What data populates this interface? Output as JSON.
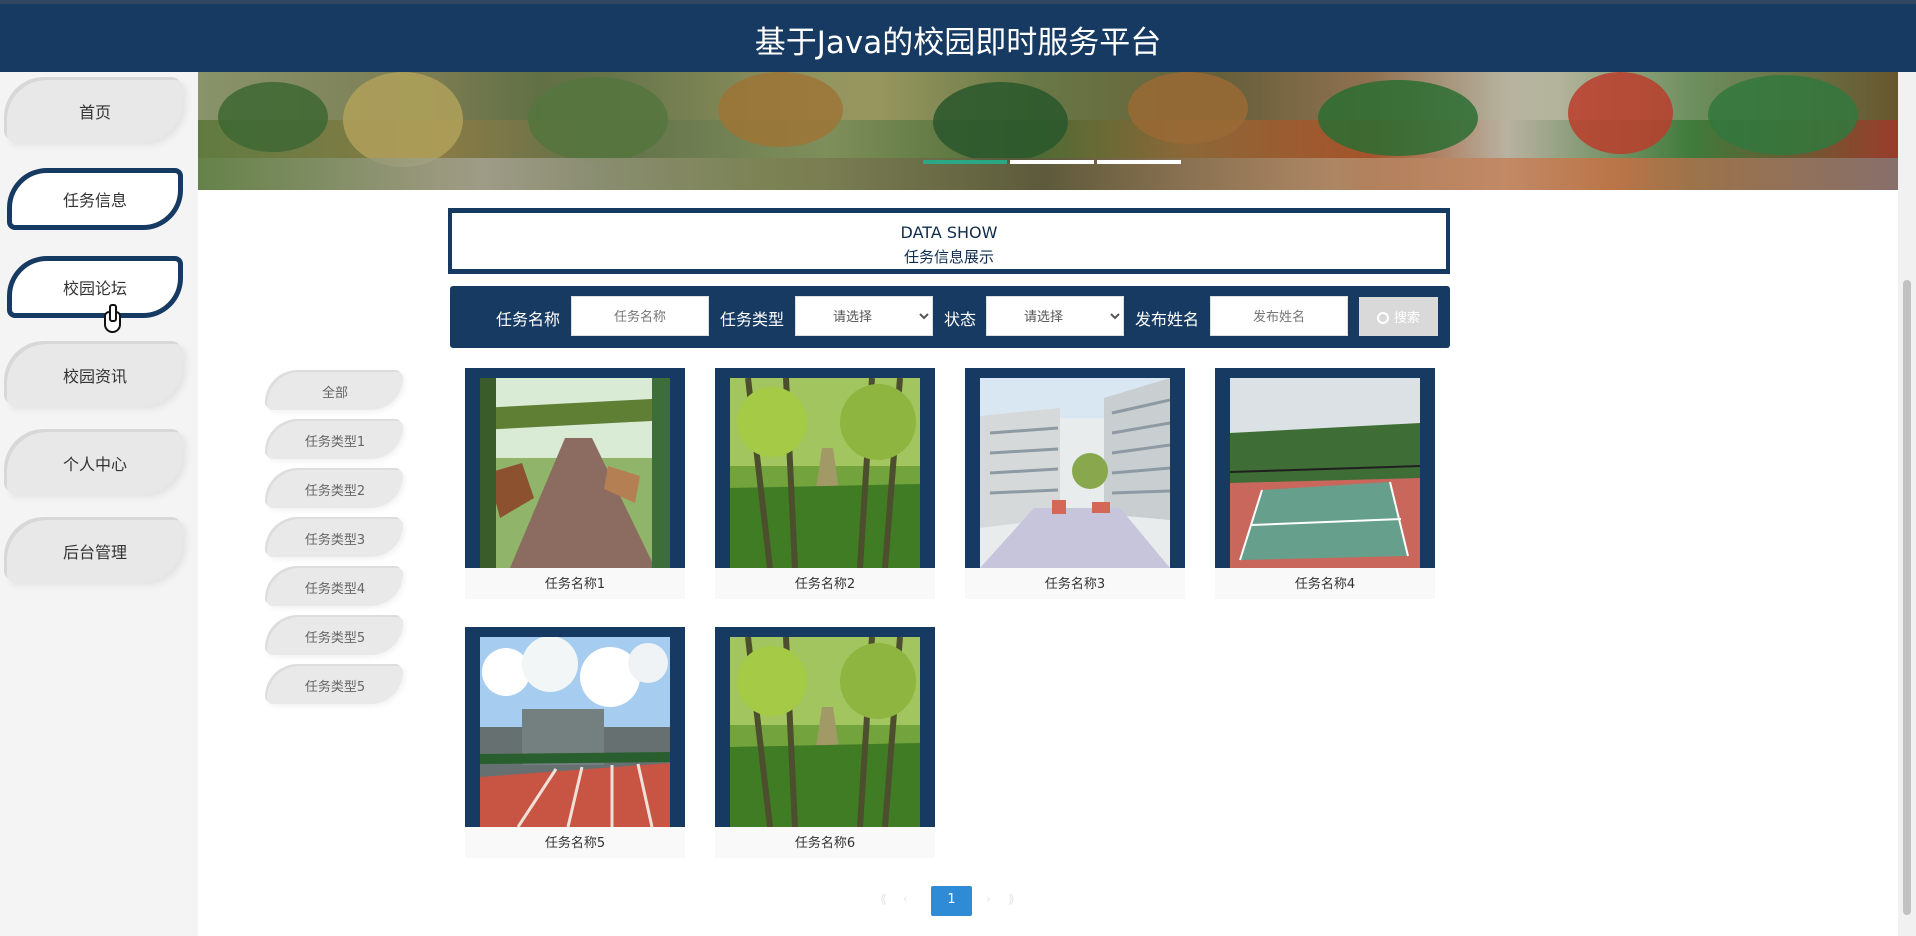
{
  "header": {
    "title": "基于Java的校园即时服务平台"
  },
  "sidebar": {
    "items": [
      {
        "label": "首页",
        "active": false
      },
      {
        "label": "任务信息",
        "active": true
      },
      {
        "label": "校园论坛",
        "active": true
      },
      {
        "label": "校园资讯",
        "active": false
      },
      {
        "label": "个人中心",
        "active": false
      },
      {
        "label": "后台管理",
        "active": false
      }
    ]
  },
  "section": {
    "title_en": "DATA SHOW",
    "title_cn": "任务信息展示"
  },
  "search": {
    "task_name_label": "任务名称",
    "task_name_placeholder": "任务名称",
    "task_type_label": "任务类型",
    "task_type_value": "请选择",
    "status_label": "状态",
    "status_value": "请选择",
    "publisher_label": "发布姓名",
    "publisher_placeholder": "发布姓名",
    "button_label": "搜索"
  },
  "categories": [
    "全部",
    "任务类型1",
    "任务类型2",
    "任务类型3",
    "任务类型4",
    "任务类型5",
    "任务类型5"
  ],
  "cards": [
    {
      "title": "任务名称1",
      "image_icon": "campus-walkway-image"
    },
    {
      "title": "任务名称2",
      "image_icon": "tree-lined-path-image"
    },
    {
      "title": "任务名称3",
      "image_icon": "campus-building-image"
    },
    {
      "title": "任务名称4",
      "image_icon": "sports-court-image"
    },
    {
      "title": "任务名称5",
      "image_icon": "running-track-image"
    },
    {
      "title": "任务名称6",
      "image_icon": "tree-lined-path-image"
    }
  ],
  "pagination": {
    "current": "1"
  },
  "colors": {
    "primary": "#173a62",
    "accent": "#2f8bd6",
    "banner_indicator": "#2aa886"
  }
}
